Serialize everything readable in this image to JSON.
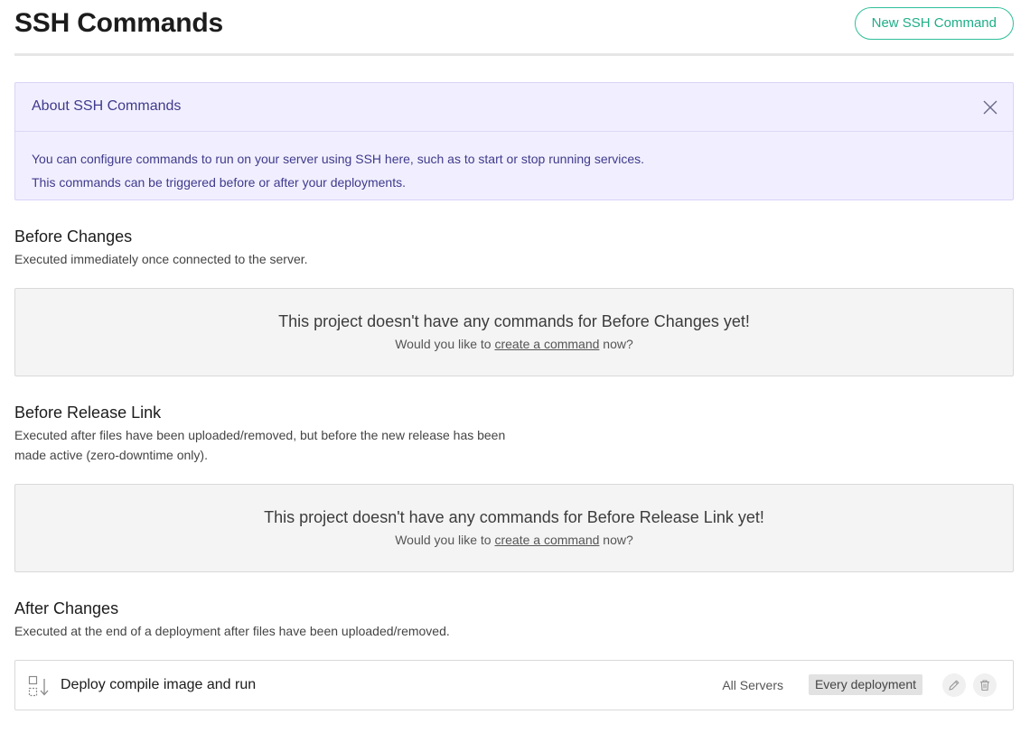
{
  "header": {
    "title": "SSH Commands",
    "new_button_label": "New SSH Command"
  },
  "info": {
    "title": "About SSH Commands",
    "lines": [
      "You can configure commands to run on your server using SSH here, such as to start or stop running services.",
      "This commands can be triggered before or after your deployments."
    ],
    "close_icon": "close-icon"
  },
  "sections": [
    {
      "title": "Before Changes",
      "description": "Executed immediately once connected to the server.",
      "empty_title": "This project doesn't have any commands for Before Changes yet!",
      "empty_prefix": "Would you like to ",
      "empty_link": "create a command",
      "empty_suffix": " now?"
    },
    {
      "title": "Before Release Link",
      "description_lines": [
        "Executed after files have been uploaded/removed, but before the new release has been",
        "made active (zero-downtime only)."
      ],
      "empty_title": "This project doesn't have any commands for Before Release Link yet!",
      "empty_prefix": "Would you like to ",
      "empty_link": "create a command",
      "empty_suffix": " now?"
    },
    {
      "title": "After Changes",
      "description": "Executed at the end of a deployment after files have been uploaded/removed.",
      "commands": [
        {
          "name": "Deploy compile image and run",
          "servers": "All Servers",
          "trigger": "Every deployment",
          "icons": [
            "drag-handle-icon",
            "pencil-icon",
            "trash-icon"
          ]
        }
      ]
    }
  ],
  "colors": {
    "accent": "#1fae88",
    "info_bg": "#f1efff",
    "info_text": "#3f3a8c",
    "empty_bg": "#f4f4f4"
  }
}
